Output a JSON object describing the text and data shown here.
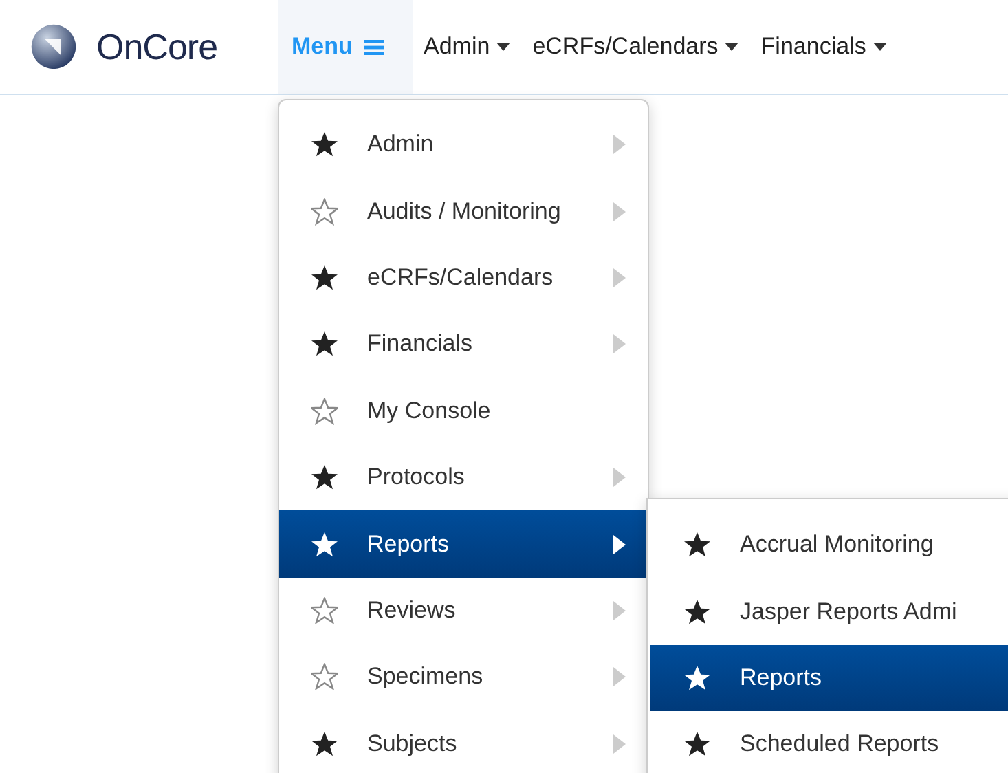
{
  "header": {
    "logo": "OnCore",
    "nav": [
      {
        "label": "Menu",
        "kind": "menu",
        "selected": true
      },
      {
        "label": "Admin",
        "kind": "dropdown",
        "selected": false
      },
      {
        "label": "eCRFs/Calendars",
        "kind": "dropdown",
        "selected": false
      },
      {
        "label": "Financials",
        "kind": "dropdown",
        "selected": false
      }
    ]
  },
  "menu": {
    "items": [
      {
        "label": "Admin",
        "favorite": true,
        "submenu": true,
        "selected": false
      },
      {
        "label": "Audits / Monitoring",
        "favorite": false,
        "submenu": true,
        "selected": false
      },
      {
        "label": "eCRFs/Calendars",
        "favorite": true,
        "submenu": true,
        "selected": false
      },
      {
        "label": "Financials",
        "favorite": true,
        "submenu": true,
        "selected": false
      },
      {
        "label": "My Console",
        "favorite": false,
        "submenu": false,
        "selected": false
      },
      {
        "label": "Protocols",
        "favorite": true,
        "submenu": true,
        "selected": false
      },
      {
        "label": "Reports",
        "favorite": true,
        "submenu": true,
        "selected": true
      },
      {
        "label": "Reviews",
        "favorite": false,
        "submenu": true,
        "selected": false
      },
      {
        "label": "Specimens",
        "favorite": false,
        "submenu": true,
        "selected": false
      },
      {
        "label": "Subjects",
        "favorite": true,
        "submenu": true,
        "selected": false
      }
    ]
  },
  "submenu": {
    "items": [
      {
        "label": "Accrual Monitoring",
        "favorite": true,
        "selected": false
      },
      {
        "label": "Jasper Reports Admi",
        "favorite": true,
        "selected": false
      },
      {
        "label": "Reports",
        "favorite": true,
        "selected": true
      },
      {
        "label": "Scheduled Reports",
        "favorite": true,
        "selected": false
      }
    ]
  }
}
